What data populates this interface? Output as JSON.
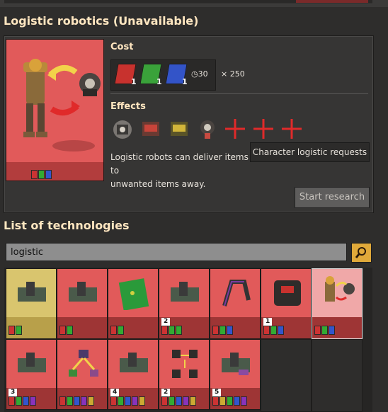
{
  "header": {
    "title": "Logistic robotics (Unavailable)"
  },
  "cost": {
    "label": "Cost",
    "packs": [
      "1",
      "1",
      "1"
    ],
    "time": "30",
    "multiplier": "× 250"
  },
  "effects": {
    "label": "Effects"
  },
  "description": {
    "line1": "Logistic robots can deliver items to",
    "line2": "unwanted items away."
  },
  "tooltip": {
    "text": "Character logistic requests"
  },
  "actions": {
    "start": "Start research"
  },
  "list": {
    "title": "List of technologies"
  },
  "search": {
    "value": "logistic"
  },
  "tiles": [
    {
      "level": "",
      "selected": "false"
    },
    {
      "level": ""
    },
    {
      "level": ""
    },
    {
      "level": "2"
    },
    {
      "level": ""
    },
    {
      "level": "1"
    },
    {
      "level": ""
    },
    {
      "level": "3"
    },
    {
      "level": ""
    },
    {
      "level": "4"
    },
    {
      "level": "2"
    },
    {
      "level": "5"
    }
  ],
  "colors": {
    "accent": "#ffe6c0",
    "tile_red": "#e15a5a",
    "tile_yellow": "#d9c56e",
    "search_button": "#e0a93a"
  }
}
